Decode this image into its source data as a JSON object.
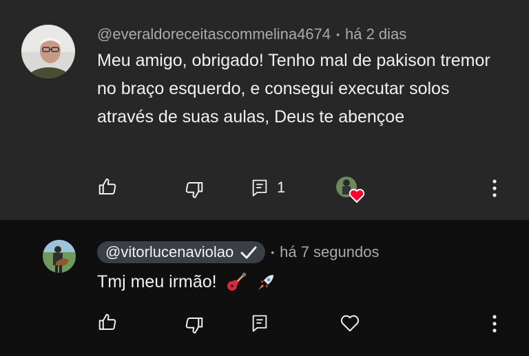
{
  "comments": [
    {
      "author": "@everaldoreceitascommelina4674",
      "time": "há 2 dias",
      "text": "Meu amigo,  obrigado! Tenho mal de pakison tremor no braço esquerdo,  e consegui executar solos através de suas aulas,  Deus te abençoe",
      "reply_count": "1",
      "avatar_icon": "elderly-man-avatar",
      "creator_heart_icon": "creator-heart-icon"
    },
    {
      "author": "@vitorlucenaviolao",
      "verified_icon": "check-icon",
      "time": "há 7 segundos",
      "text": "Tmj meu irmão!",
      "emojis": [
        "guitar-emoji",
        "rocket-emoji"
      ],
      "avatar_icon": "guitarist-avatar"
    }
  ],
  "colors": {
    "highlight_bg": "#272727",
    "page_bg": "#0f0f0f",
    "secondary_text": "#aaaaaa",
    "heart_red": "#ff0033",
    "pill_bg": "#3a3f47"
  }
}
